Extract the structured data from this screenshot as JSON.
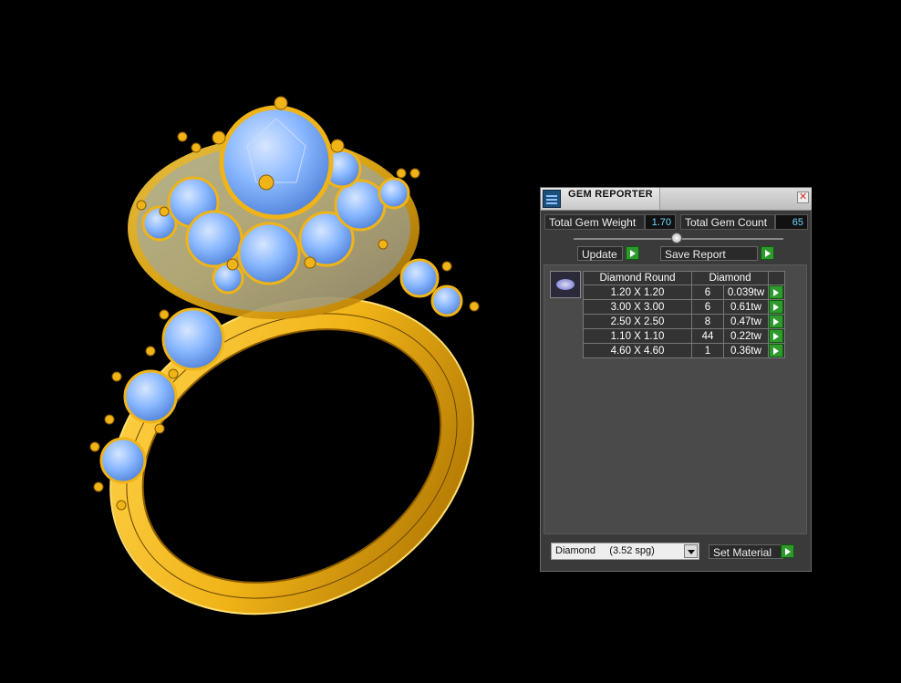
{
  "colors": {
    "accent_green": "#2e9a2e",
    "value_cyan": "#6fd8ff",
    "gold": "#f0b418",
    "gem_blue": "#8ab8ff"
  },
  "window": {
    "title": "GEM REPORTER"
  },
  "stats": {
    "weight_label": "Total Gem Weight",
    "weight_value": "1.70",
    "count_label": "Total Gem Count",
    "count_value": "65"
  },
  "toolbar": {
    "update_label": "Update",
    "save_label": "Save Report"
  },
  "table": {
    "headers": [
      "Diamond Round",
      "Diamond"
    ],
    "rows": [
      {
        "size": "1.20 X 1.20",
        "count": "6",
        "weight": "0.039tw"
      },
      {
        "size": "3.00 X 3.00",
        "count": "6",
        "weight": "0.61tw"
      },
      {
        "size": "2.50 X 2.50",
        "count": "8",
        "weight": "0.47tw"
      },
      {
        "size": "1.10 X 1.10",
        "count": "44",
        "weight": "0.22tw"
      },
      {
        "size": "4.60 X 4.60",
        "count": "1",
        "weight": "0.36tw"
      }
    ]
  },
  "material": {
    "selected": "Diamond     (3.52 spg)",
    "set_label": "Set Material"
  },
  "icons": {
    "app": "gem-reporter-icon",
    "close": "close-icon",
    "go": "play-arrow-icon",
    "gem": "round-gem-icon"
  }
}
